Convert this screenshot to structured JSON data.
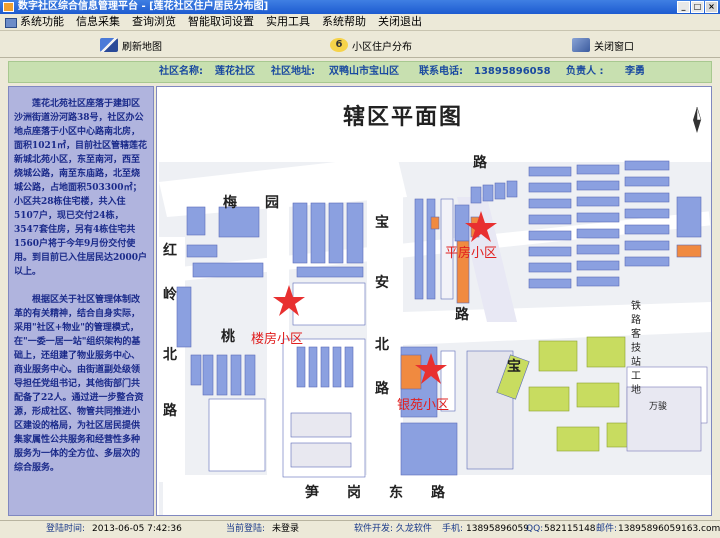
{
  "window": {
    "title": "数字社区综合信息管理平台 - [莲花社区住户居民分布图]",
    "buttons": [
      "_",
      "□",
      "×"
    ]
  },
  "menu": {
    "items": [
      "系统功能",
      "信息采集",
      "查询浏览",
      "智能取词设置",
      "实用工具",
      "系统帮助",
      "关闭退出"
    ]
  },
  "toolbar": {
    "refresh_label": "刷新地图",
    "residents_label": "小区住户分布",
    "residents_icon_text": "6",
    "close_label": "关闭窗口"
  },
  "info": {
    "name_label": "社区名称:",
    "name_value": "莲花社区",
    "address_label": "社区地址:",
    "address_value": "双鸭山市宝山区",
    "phone_label": "联系电话:",
    "phone_value": "13895896058",
    "head_label": "负责人 :",
    "head_value": "李勇"
  },
  "description": {
    "p1": "莲花北苑社区座落于建卸区沙洲街道汾河路38号，社区办公地点座落于小区中心路南北房，面积1021㎡，目前社区管辖莲花新城北苑小区，东至南河，西至烧城公路，南至东庙路，北至烧城公路，占地面积503300㎡；小区共28栋住宅楼，共入住5107户，现已交付24栋，3547套住房，另有4栋住宅共1560户将于今年9月份交付使用。到目前已入住居民达2000户以上。",
    "p2": "根据区关于社区管理体制改革的有关精神，结合自身实际，采用\"社区+物业\"的管理模式，在\"一委一居一站\"组织架构的基础上，还组建了物业服务中心、商业服务中心。由街道副处级领导担任党组书记，其他街部门共配备了22人。通过进一步整合资源，形成社区、物管共同推进小区建设的格局，为社区居民提供集家属性公共服务和经营性多种服务为一体的全方位、多层次的综合服务。"
  },
  "map": {
    "title": "辖区平面图",
    "roads": {
      "north_road": "路",
      "meiyuan": "梅　　园",
      "baoan": "宝　　安",
      "hongling": "红　岭",
      "taoyuan": "桃　园",
      "beilu": "北　路",
      "beilu2": "北　路",
      "sungang": "笋　　岗　　东　　路",
      "baogang": "宝",
      "lu_mid": "路",
      "lu_mid2": "路"
    },
    "zones": [
      "平房小区",
      "楼房小区",
      "银苑小区"
    ],
    "station": "铁路客技站工地",
    "wanhuan": "万骏",
    "colors": {
      "building_blue": "#8ba0e0",
      "building_orange": "#f08a40",
      "star_red": "#e83030",
      "zone_text": "#e02020",
      "green": "#c8dc60"
    }
  },
  "status": {
    "login_label": "登陆时间:",
    "login_value": "2013-06-05 7:42:36",
    "current_label": "当前登陆:",
    "current_value": "未登录",
    "dev_label": "软件开发: 久龙软件",
    "phone_label": "手机:",
    "phone_value": "13895896059",
    "qq_label": "QQ:",
    "qq_value": "582115148",
    "email_label": "邮件:",
    "email_value": "13895896059163.com"
  }
}
